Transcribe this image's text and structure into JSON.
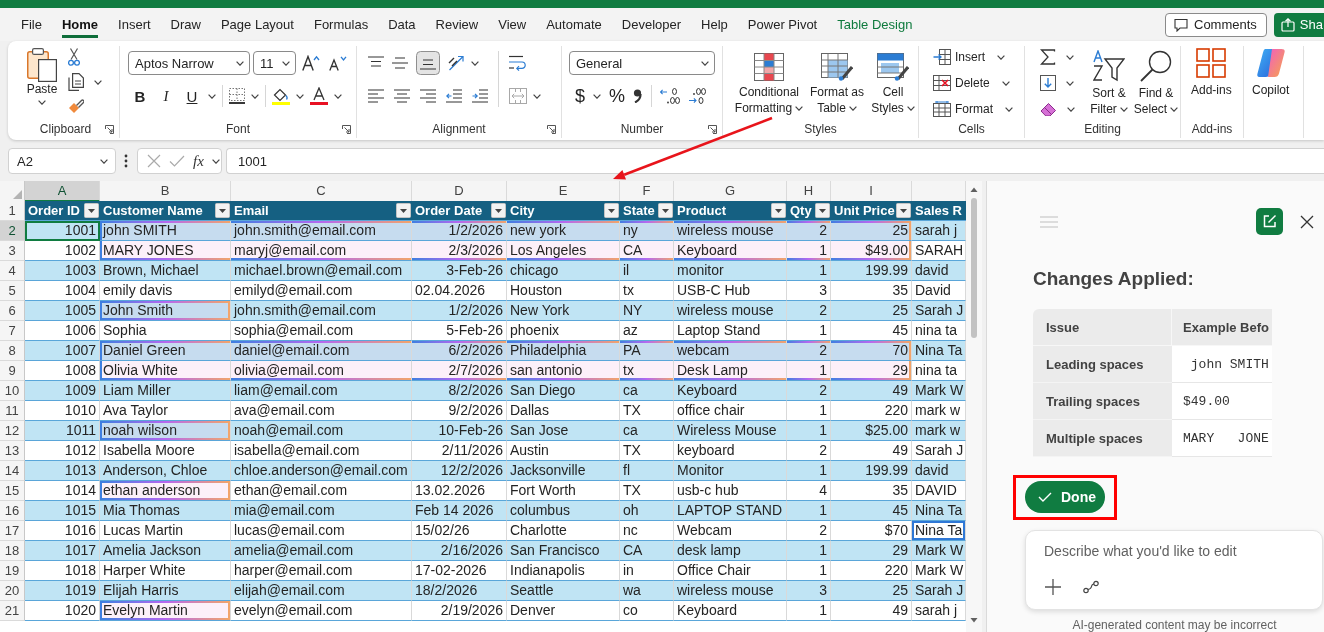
{
  "menu": {
    "tabs": [
      {
        "label": "File",
        "selected": false,
        "kind": "standard"
      },
      {
        "label": "Home",
        "selected": true,
        "kind": "standard"
      },
      {
        "label": "Insert",
        "selected": false,
        "kind": "standard"
      },
      {
        "label": "Draw",
        "selected": false,
        "kind": "standard"
      },
      {
        "label": "Page Layout",
        "selected": false,
        "kind": "standard"
      },
      {
        "label": "Formulas",
        "selected": false,
        "kind": "standard"
      },
      {
        "label": "Data",
        "selected": false,
        "kind": "standard"
      },
      {
        "label": "Review",
        "selected": false,
        "kind": "standard"
      },
      {
        "label": "View",
        "selected": false,
        "kind": "standard"
      },
      {
        "label": "Automate",
        "selected": false,
        "kind": "standard"
      },
      {
        "label": "Developer",
        "selected": false,
        "kind": "standard"
      },
      {
        "label": "Help",
        "selected": false,
        "kind": "standard"
      },
      {
        "label": "Power Pivot",
        "selected": false,
        "kind": "standard"
      },
      {
        "label": "Table Design",
        "selected": false,
        "kind": "contextual"
      }
    ],
    "comments": "Comments",
    "share": "Sha"
  },
  "ribbon": {
    "groups": [
      {
        "kind": "clipboard",
        "label": "Clipboard",
        "launcher": true,
        "paste": "Paste"
      },
      {
        "kind": "font",
        "label": "Font",
        "launcher": true,
        "font_name": "Aptos Narrow",
        "font_size": "11",
        "bold": "B",
        "italic": "I",
        "underline": "U"
      },
      {
        "kind": "alignment",
        "label": "Alignment",
        "launcher": true,
        "vertical_align": [
          {
            "kind": "top",
            "selected": false
          },
          {
            "kind": "middle",
            "selected": false
          },
          {
            "kind": "bottom",
            "selected": true
          }
        ]
      },
      {
        "kind": "number",
        "label": "Number",
        "launcher": true,
        "format": "General",
        "currency": "$",
        "percent": "%"
      },
      {
        "kind": "styles",
        "label": "Styles",
        "buttons": [
          {
            "kind": "conditional",
            "label": "Conditional Formatting"
          },
          {
            "kind": "table",
            "label": "Format as Table"
          },
          {
            "kind": "cell_styles",
            "label": "Cell Styles"
          }
        ]
      },
      {
        "kind": "cells",
        "label": "Cells",
        "buttons": [
          {
            "kind": "insert",
            "label": "Insert"
          },
          {
            "kind": "delete",
            "label": "Delete"
          },
          {
            "kind": "format",
            "label": "Format"
          }
        ]
      },
      {
        "kind": "editing",
        "label": "Editing",
        "buttons": [
          {
            "kind": "sort",
            "label": "Sort & Filter"
          },
          {
            "kind": "find",
            "label": "Find & Select"
          }
        ]
      },
      {
        "kind": "addins",
        "label": "Add-ins",
        "button": "Add-ins"
      },
      {
        "kind": "copilot",
        "button": "Copilot"
      }
    ]
  },
  "formula_bar": {
    "name_box": "A2",
    "function_label": "fx",
    "formula": "1001"
  },
  "sheet": {
    "header_row_number": "1",
    "columns": [
      {
        "letter": "A",
        "selected": true,
        "header": "Order ID",
        "kind": "number",
        "filter": true
      },
      {
        "letter": "B",
        "selected": false,
        "header": "Customer Name",
        "kind": "text",
        "filter": true
      },
      {
        "letter": "C",
        "selected": false,
        "header": "Email",
        "kind": "text",
        "filter": true
      },
      {
        "letter": "D",
        "selected": false,
        "header": "Order Date",
        "kind": "date",
        "filter": true
      },
      {
        "letter": "E",
        "selected": false,
        "header": "City",
        "kind": "text",
        "filter": true
      },
      {
        "letter": "F",
        "selected": false,
        "header": "State",
        "kind": "text",
        "filter": true
      },
      {
        "letter": "G",
        "selected": false,
        "header": "Product",
        "kind": "text",
        "filter": true
      },
      {
        "letter": "H",
        "selected": false,
        "header": "Qty",
        "kind": "number",
        "filter": true
      },
      {
        "letter": "I",
        "selected": false,
        "header": "Unit Price",
        "kind": "number",
        "filter": true
      },
      {
        "selected": false,
        "header": "Sales R",
        "kind": "text",
        "filter": false
      }
    ],
    "rows": [
      {
        "number": "2",
        "selected": true,
        "text_date": false,
        "row_changed": true,
        "name_changed": false,
        "rep_flagged": false,
        "cells": [
          "1001",
          "john SMITH",
          "john.smith@email.com",
          "1/2/2026",
          "new york",
          "ny",
          "wireless mouse",
          "2",
          "25",
          "sarah j"
        ]
      },
      {
        "number": "3",
        "selected": false,
        "text_date": false,
        "row_changed": true,
        "name_changed": false,
        "rep_flagged": false,
        "cells": [
          "1002",
          "MARY JONES",
          "maryj@email.com",
          "2/3/2026",
          "Los Angeles",
          "CA",
          "Keyboard",
          "1",
          "$49.00",
          "SARAH"
        ]
      },
      {
        "number": "4",
        "selected": false,
        "text_date": false,
        "row_changed": false,
        "name_changed": false,
        "rep_flagged": false,
        "cells": [
          "1003",
          "Brown, Michael",
          "michael.brown@email.com",
          "3-Feb-26",
          "chicago",
          "il",
          "monitor",
          "1",
          "199.99",
          "david"
        ]
      },
      {
        "number": "5",
        "selected": false,
        "text_date": true,
        "row_changed": false,
        "name_changed": false,
        "rep_flagged": false,
        "cells": [
          "1004",
          "emily davis",
          "emilyd@email.com",
          "02.04.2026",
          "Houston",
          "tx",
          "USB-C Hub",
          "3",
          "35",
          "David"
        ]
      },
      {
        "number": "6",
        "selected": false,
        "text_date": false,
        "row_changed": false,
        "name_changed": true,
        "rep_flagged": false,
        "cells": [
          "1005",
          "John Smith",
          "john.smith@email.com",
          "1/2/2026",
          "New York",
          "NY",
          "wireless mouse",
          "2",
          "25",
          "Sarah J"
        ]
      },
      {
        "number": "7",
        "selected": false,
        "text_date": false,
        "row_changed": false,
        "name_changed": false,
        "rep_flagged": false,
        "cells": [
          "1006",
          "Sophia",
          "sophia@email.com",
          "5-Feb-26",
          "phoenix",
          "az",
          "Laptop Stand",
          "1",
          "45",
          "nina ta"
        ]
      },
      {
        "number": "8",
        "selected": false,
        "text_date": false,
        "row_changed": true,
        "name_changed": false,
        "rep_flagged": false,
        "cells": [
          "1007",
          "Daniel Green",
          "daniel@email.com",
          "6/2/2026",
          "Philadelphia",
          "PA",
          "webcam",
          "2",
          "70",
          "Nina Ta"
        ]
      },
      {
        "number": "9",
        "selected": false,
        "text_date": false,
        "row_changed": true,
        "name_changed": false,
        "rep_flagged": false,
        "cells": [
          "1008",
          "Olivia White",
          "olivia@email.com",
          "2/7/2026",
          "san antonio",
          "tx",
          "Desk Lamp",
          "1",
          "29",
          "nina ta"
        ]
      },
      {
        "number": "10",
        "selected": false,
        "text_date": false,
        "row_changed": false,
        "name_changed": false,
        "rep_flagged": false,
        "cells": [
          "1009",
          "Liam Miller",
          "liam@email.com",
          "8/2/2026",
          "San Diego",
          "ca",
          "Keyboard",
          "2",
          "49",
          "Mark W"
        ]
      },
      {
        "number": "11",
        "selected": false,
        "text_date": false,
        "row_changed": false,
        "name_changed": false,
        "rep_flagged": false,
        "cells": [
          "1010",
          "Ava Taylor",
          "ava@email.com",
          "9/2/2026",
          "Dallas",
          "TX",
          "office chair",
          "1",
          "220",
          "mark w"
        ]
      },
      {
        "number": "12",
        "selected": false,
        "text_date": false,
        "row_changed": false,
        "name_changed": true,
        "rep_flagged": false,
        "cells": [
          "1011",
          "noah wilson",
          "noah@email.com",
          "10-Feb-26",
          "San Jose",
          "ca",
          "Wireless Mouse",
          "1",
          "$25.00",
          "mark w"
        ]
      },
      {
        "number": "13",
        "selected": false,
        "text_date": false,
        "row_changed": false,
        "name_changed": false,
        "rep_flagged": false,
        "cells": [
          "1012",
          "Isabella Moore",
          "isabella@email.com",
          "2/11/2026",
          "Austin",
          "TX",
          "keyboard",
          "2",
          "49",
          "Sarah J"
        ]
      },
      {
        "number": "14",
        "selected": false,
        "text_date": false,
        "row_changed": false,
        "name_changed": false,
        "rep_flagged": false,
        "cells": [
          "1013",
          "Anderson, Chloe",
          "chloe.anderson@email.com",
          "12/2/2026",
          "Jacksonville",
          "fl",
          "Monitor",
          "1",
          "199.99",
          "david"
        ]
      },
      {
        "number": "15",
        "selected": false,
        "text_date": true,
        "row_changed": false,
        "name_changed": true,
        "rep_flagged": false,
        "cells": [
          "1014",
          "ethan anderson",
          "ethan@email.com",
          "13.02.2026",
          "Fort Worth",
          "TX",
          "usb-c hub",
          "4",
          "35",
          "DAVID"
        ]
      },
      {
        "number": "16",
        "selected": false,
        "text_date": true,
        "row_changed": false,
        "name_changed": false,
        "rep_flagged": false,
        "cells": [
          "1015",
          "Mia Thomas",
          "mia@email.com",
          "Feb 14 2026",
          "columbus",
          "oh",
          "LAPTOP STAND",
          "1",
          "45",
          "Nina Ta"
        ]
      },
      {
        "number": "17",
        "selected": false,
        "text_date": true,
        "row_changed": false,
        "name_changed": false,
        "rep_flagged": true,
        "cells": [
          "1016",
          "Lucas Martin",
          "lucas@email.com",
          "15/02/26",
          "Charlotte",
          "nc",
          "Webcam",
          "2",
          "$70",
          "Nina Ta"
        ]
      },
      {
        "number": "18",
        "selected": false,
        "text_date": false,
        "row_changed": false,
        "name_changed": false,
        "rep_flagged": false,
        "cells": [
          "1017",
          "Amelia Jackson",
          "amelia@email.com",
          "2/16/2026",
          "San Francisco",
          "CA",
          "desk lamp",
          "1",
          "29",
          "Mark W"
        ]
      },
      {
        "number": "19",
        "selected": false,
        "text_date": true,
        "row_changed": false,
        "name_changed": false,
        "rep_flagged": false,
        "cells": [
          "1018",
          "Harper White",
          "harper@email.com",
          "17-02-2026",
          "Indianapolis",
          "in",
          "Office Chair",
          "1",
          "220",
          "Mark W"
        ]
      },
      {
        "number": "20",
        "selected": false,
        "text_date": true,
        "row_changed": false,
        "name_changed": false,
        "rep_flagged": false,
        "cells": [
          "1019",
          "Elijah Harris",
          "elijah@email.com",
          "18/2/2026",
          "Seattle",
          "wa",
          "wireless mouse",
          "3",
          "25",
          "Sarah J"
        ]
      },
      {
        "number": "21",
        "selected": false,
        "text_date": false,
        "row_changed": false,
        "name_changed": true,
        "rep_flagged": false,
        "cells": [
          "1020",
          "Evelyn Martin",
          "evelyn@email.com",
          "2/19/2026",
          "Denver",
          "co",
          "Keyboard",
          "1",
          "49",
          "sarah j"
        ]
      }
    ]
  },
  "copilot_panel": {
    "title": "Changes Applied:",
    "table": {
      "columns": [
        "Issue",
        "Example Befo"
      ],
      "rows": [
        [
          "Leading spaces",
          " john SMITH"
        ],
        [
          "Trailing spaces",
          "$49.00"
        ],
        [
          "Multiple spaces",
          "MARY   JONE"
        ]
      ]
    },
    "done_button": "Done",
    "prompt": {
      "placeholder": "Describe what you'd like to edit"
    },
    "disclaimer": "AI-generated content may be incorrect"
  },
  "annotations": {
    "arrow": true,
    "frame": true
  }
}
